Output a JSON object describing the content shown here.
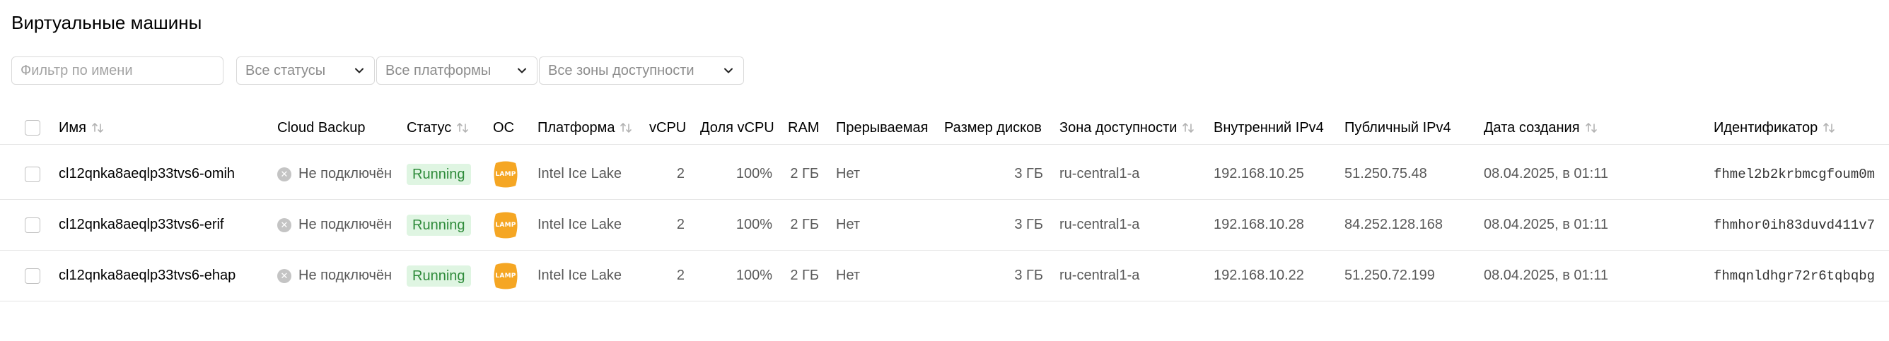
{
  "page": {
    "title": "Виртуальные машины"
  },
  "filters": {
    "name_placeholder": "Фильтр по имени",
    "status": "Все статусы",
    "platform": "Все платформы",
    "zone": "Все зоны доступности"
  },
  "table": {
    "columns": {
      "name": "Имя",
      "backup": "Cloud Backup",
      "status": "Статус",
      "os": "ОС",
      "platform": "Платформа",
      "vcpu": "vCPU",
      "vcpu_share": "Доля vCPU",
      "ram": "RAM",
      "preemptible": "Прерываемая",
      "disk_size": "Размер дисков",
      "zone": "Зона доступности",
      "internal_ip": "Внутренний IPv4",
      "public_ip": "Публичный IPv4",
      "created": "Дата создания",
      "id": "Идентификатор"
    },
    "rows": [
      {
        "name": "cl12qnka8aeqlp33tvs6-omih",
        "backup": "Не подключён",
        "status": "Running",
        "os_logo": "LAMP",
        "platform": "Intel Ice Lake",
        "vcpu": "2",
        "vcpu_share": "100%",
        "ram": "2 ГБ",
        "preemptible": "Нет",
        "disk_size": "3 ГБ",
        "zone": "ru-central1-a",
        "internal_ip": "192.168.10.25",
        "public_ip": "51.250.75.48",
        "created": "08.04.2025, в 01:11",
        "id": "fhmel2b2krbmcgfoum0m"
      },
      {
        "name": "cl12qnka8aeqlp33tvs6-erif",
        "backup": "Не подключён",
        "status": "Running",
        "os_logo": "LAMP",
        "platform": "Intel Ice Lake",
        "vcpu": "2",
        "vcpu_share": "100%",
        "ram": "2 ГБ",
        "preemptible": "Нет",
        "disk_size": "3 ГБ",
        "zone": "ru-central1-a",
        "internal_ip": "192.168.10.28",
        "public_ip": "84.252.128.168",
        "created": "08.04.2025, в 01:11",
        "id": "fhmhor0ih83duvd411v7"
      },
      {
        "name": "cl12qnka8aeqlp33tvs6-ehap",
        "backup": "Не подключён",
        "status": "Running",
        "os_logo": "LAMP",
        "platform": "Intel Ice Lake",
        "vcpu": "2",
        "vcpu_share": "100%",
        "ram": "2 ГБ",
        "preemptible": "Нет",
        "disk_size": "3 ГБ",
        "zone": "ru-central1-a",
        "internal_ip": "192.168.10.22",
        "public_ip": "51.250.72.199",
        "created": "08.04.2025, в 01:11",
        "id": "fhmqnldhgr72r6tqbqbg"
      }
    ]
  },
  "colors": {
    "status_running_bg": "#dff5e2",
    "status_running_text": "#2e8b3a",
    "os_logo": "#f5a623"
  },
  "icons": {
    "sort": "sort-arrows-icon",
    "dropdown": "chevron-down-icon",
    "backup_disconnected": "x-circle-icon",
    "os": "lamp-logo-icon"
  }
}
